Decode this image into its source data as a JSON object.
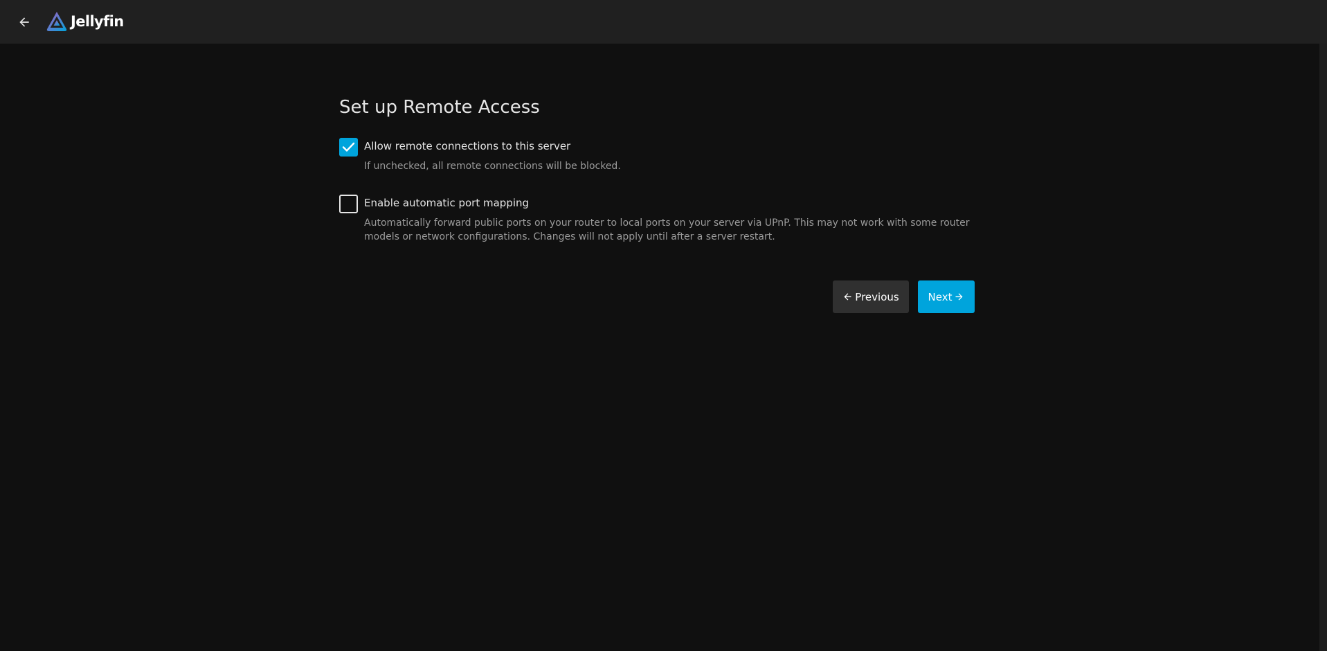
{
  "header": {
    "app_name": "Jellyfin",
    "back_icon": "arrow-left-icon",
    "logo_icon": "jellyfin-logo-icon"
  },
  "page": {
    "title": "Set up Remote Access"
  },
  "options": [
    {
      "label": "Allow remote connections to this server",
      "description": "If unchecked, all remote connections will be blocked.",
      "checked": true
    },
    {
      "label": "Enable automatic port mapping",
      "description": "Automatically forward public ports on your router to local ports on your server via UPnP. This may not work with some router models or network configurations. Changes will not apply until after a server restart.",
      "checked": false
    }
  ],
  "buttons": {
    "previous_label": "Previous",
    "next_label": "Next"
  },
  "colors": {
    "accent": "#00a4dc",
    "header_bg": "#202020",
    "page_bg": "#101010",
    "secondary_button": "#303030"
  }
}
